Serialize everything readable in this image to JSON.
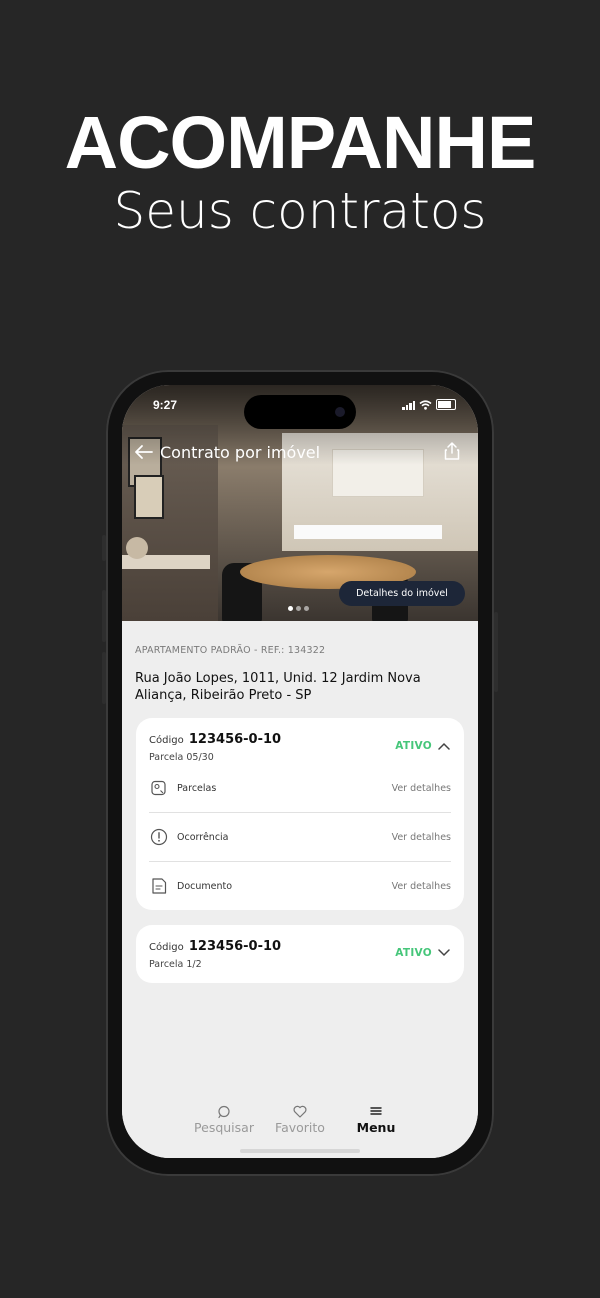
{
  "promo": {
    "headline": "ACOMPANHE",
    "subline": "Seus contratos"
  },
  "status_bar": {
    "time": "9:27"
  },
  "nav": {
    "title": "Contrato por imóvel"
  },
  "hero": {
    "details_button": "Detalhes do imóvel"
  },
  "property": {
    "ref": "APARTAMENTO PADRÃO - REF.: 134322",
    "address": "Rua João Lopes, 1011, Unid. 12 Jardim Nova Aliança, Ribeirão Preto - SP"
  },
  "contracts": [
    {
      "code_label": "Código",
      "code": "123456-0-10",
      "parcela": "Parcela 05/30",
      "status": "ATIVO",
      "expanded": true,
      "items": [
        {
          "label": "Parcelas",
          "action": "Ver detalhes",
          "icon": "installments-icon"
        },
        {
          "label": "Ocorrência",
          "action": "Ver detalhes",
          "icon": "alert-icon"
        },
        {
          "label": "Documento",
          "action": "Ver detalhes",
          "icon": "document-icon"
        }
      ]
    },
    {
      "code_label": "Código",
      "code": "123456-0-10",
      "parcela": "Parcela 1/2",
      "status": "ATIVO",
      "expanded": false
    }
  ],
  "tabbar": {
    "items": [
      {
        "label": "Pesquisar",
        "icon": "search-icon",
        "active": false
      },
      {
        "label": "Favorito",
        "icon": "heart-icon",
        "active": false
      },
      {
        "label": "Menu",
        "icon": "menu-icon",
        "active": true
      }
    ]
  },
  "colors": {
    "background": "#262626",
    "status_active": "#46c67a",
    "button_navy": "#1d2638"
  }
}
